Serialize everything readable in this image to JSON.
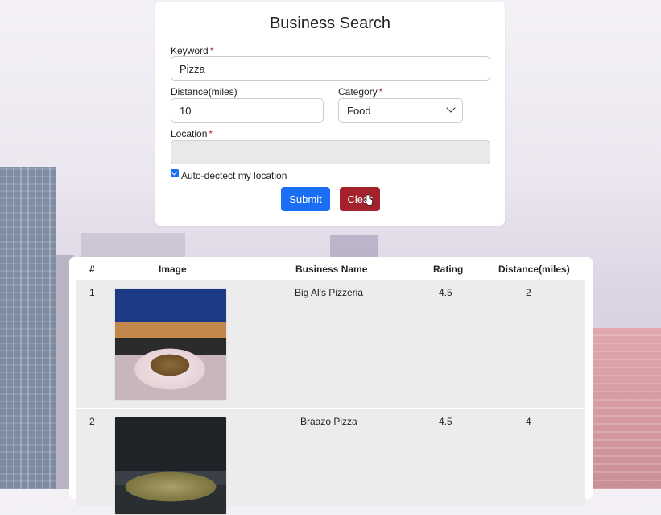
{
  "form": {
    "title": "Business Search",
    "keyword_label": "Keyword",
    "keyword_value": "Pizza",
    "distance_label": "Distance(miles)",
    "distance_value": "10",
    "category_label": "Category",
    "category_value": "Food",
    "location_label": "Location",
    "location_value": "",
    "required_mark": "*",
    "auto_detect_label": "Auto-dectect my location",
    "auto_detect_checked": true,
    "submit_label": "Submit",
    "clear_label": "Clear"
  },
  "results": {
    "headers": [
      "#",
      "Image",
      "Business Name",
      "Rating",
      "Distance(miles)"
    ],
    "rows": [
      {
        "index": "1",
        "name": "Big Al's Pizzeria",
        "rating": "4.5",
        "distance": "2"
      },
      {
        "index": "2",
        "name": "Braazo Pizza",
        "rating": "4.5",
        "distance": "4"
      }
    ]
  },
  "colors": {
    "primary": "#1a6ef5",
    "danger": "#a3222c",
    "required": "#c0262d"
  }
}
